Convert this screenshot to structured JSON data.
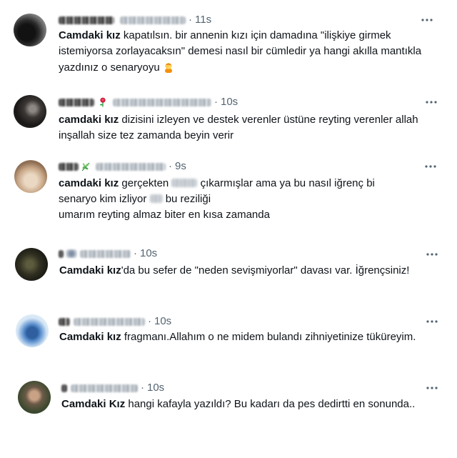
{
  "colors": {
    "text": "#0f1419",
    "muted": "#536471",
    "background": "#ffffff"
  },
  "icons": {
    "more": "more-options-icon"
  },
  "tweets": [
    {
      "separator": "·",
      "time": "11s",
      "text_emoji_icon": "facepalm-emoji",
      "text": {
        "lead": "Camdaki kız",
        "l1": " kapatılsın. bir annenin kızı için damadına \"ilişkiye girmek",
        "l2": "istemiyorsa zorlayacaksın\" demesi nasıl bir cümledir ya hangi akılla mantıkla",
        "l3": "yazdınız o senaryoyu "
      }
    },
    {
      "separator": "·",
      "time": "10s",
      "name_emoji_icon": "rose-emoji",
      "text": {
        "lead": "camdaki kız",
        "l1": " dizisini izleyen ve destek verenler üstüne reyting verenler allah",
        "l2": "inşallah size tez zamanda beyin verir"
      }
    },
    {
      "separator": "·",
      "time": "9s",
      "name_emoji_icon": "herb-emoji",
      "text": {
        "lead": "camdaki kız",
        "l1a": " gerçekten ",
        "l1b": " çıkarmışlar ama ya bu nasıl iğrenç bi",
        "l2a": "senaryo kim izliyor ",
        "l2b": " bu reziliği",
        "l3": "umarım reyting almaz biter en kısa zamanda"
      }
    },
    {
      "separator": "·",
      "time": "10s",
      "text": {
        "lead": "Camdaki kız",
        "l1": "'da bu sefer de \"neden sevişmiyorlar\" davası var. İğrençsiniz!"
      }
    },
    {
      "separator": "·",
      "time": "10s",
      "text": {
        "lead": "Camdaki kız",
        "l1": " fragmanı.Allahım o ne midem bulandı zihniyetinize tüküreyim."
      }
    },
    {
      "separator": "·",
      "time": "10s",
      "text": {
        "lead": "Camdaki Kız",
        "l1": " hangi kafayla yazıldı? Bu kadarı da pes dedirtti en sonunda.."
      }
    }
  ]
}
